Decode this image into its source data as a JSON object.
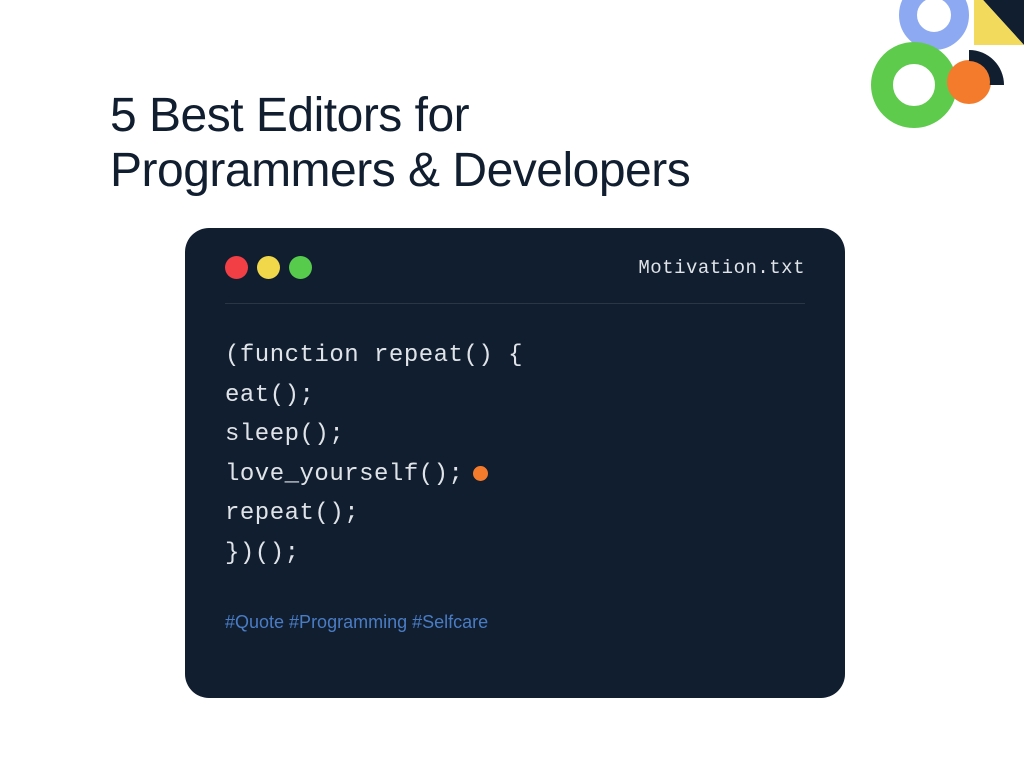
{
  "title": "5 Best Editors for\nProgrammers & Developers",
  "editor": {
    "filename": "Motivation.txt",
    "code_lines": [
      "(function repeat() {",
      "eat();",
      "sleep();",
      "love_yourself();",
      "repeat();",
      "})();"
    ],
    "cursor_line_index": 3,
    "hashtags": "#Quote #Programming #Selfcare"
  },
  "colors": {
    "window_bg": "#101E30",
    "red": "#F13F45",
    "yellow": "#F0D84A",
    "green": "#56CB4C",
    "orange": "#F47B2C",
    "blue_ring": "#8CA9F2",
    "green_ring": "#5ECB4C",
    "dark_triangle": "#101E30",
    "hashtag": "#4A7CC4"
  }
}
